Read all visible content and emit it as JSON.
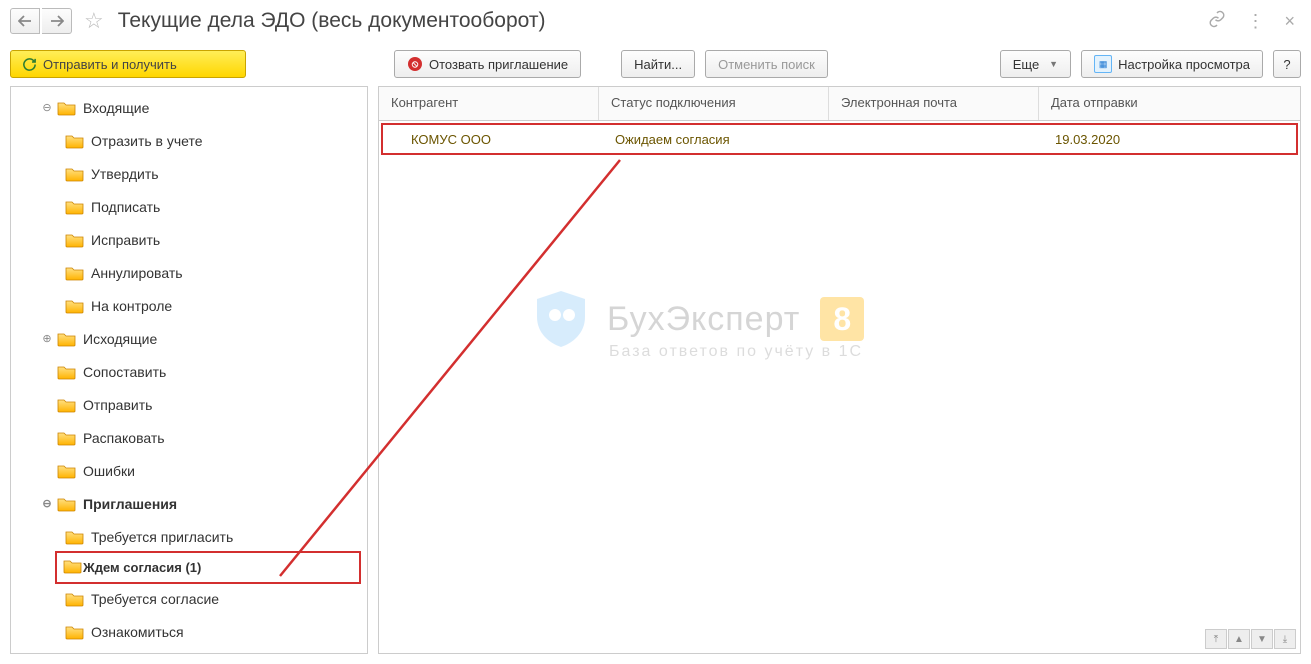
{
  "title": "Текущие дела ЭДО (весь документооборот)",
  "toolbar": {
    "send_receive": "Отправить и получить",
    "revoke_invitation": "Отозвать приглашение",
    "find": "Найти...",
    "cancel_search": "Отменить поиск",
    "more": "Еще",
    "view_settings": "Настройка просмотра",
    "help": "?"
  },
  "tree": {
    "inbox": "Входящие",
    "inbox_children": {
      "reflect": "Отразить в учете",
      "approve": "Утвердить",
      "sign": "Подписать",
      "fix": "Исправить",
      "cancel": "Аннулировать",
      "on_control": "На контроле"
    },
    "outbox": "Исходящие",
    "compare": "Сопоставить",
    "send": "Отправить",
    "unpack": "Распаковать",
    "errors": "Ошибки",
    "invitations": "Приглашения",
    "inv_children": {
      "need_invite": "Требуется пригласить",
      "wait_consent": "Ждем согласия (1)",
      "need_consent": "Требуется согласие",
      "review": "Ознакомиться"
    }
  },
  "table": {
    "headers": {
      "counterparty": "Контрагент",
      "status": "Статус подключения",
      "email": "Электронная почта",
      "send_date": "Дата отправки"
    },
    "row": {
      "counterparty": "КОМУС ООО",
      "status": "Ожидаем согласия",
      "email": "",
      "send_date": "19.03.2020"
    }
  },
  "watermark": {
    "brand": "БухЭксперт",
    "eight": "8",
    "sub": "База ответов по учёту в 1С"
  }
}
